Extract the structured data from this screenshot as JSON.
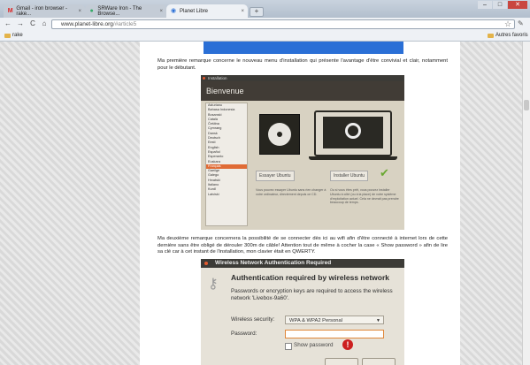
{
  "tabs": [
    {
      "icon": "gmail-icon",
      "label": "Gmail - iron browser - rake...",
      "close": "×"
    },
    {
      "icon": "srware-icon",
      "label": "SRWare Iron - The Browse...",
      "close": "×"
    },
    {
      "icon": "planet-icon",
      "label": "Planet Libre",
      "close": "×"
    }
  ],
  "new_tab": "+",
  "window_controls": {
    "minimize": "–",
    "maximize": "□",
    "close": "✕"
  },
  "nav": {
    "back": "←",
    "forward": "→",
    "reload": "C",
    "home": "⌂"
  },
  "address": {
    "host": "www.planet-libre.org",
    "path": "/#article5"
  },
  "bookmarks": {
    "left": "rake",
    "right": "Autres favoris"
  },
  "article": {
    "para1": "Ma première remarque concerne le nouveau menu d'installation qui présente l'avantage d'être convivial et clair, notamment pour le débutant.",
    "para2": "Ma deuxième remarque concernera la possibilité de se connecter dès ici au wifi afin d'être connecté à internet lors de cette dernière sans être obligé de dérouler 300m de câble! Attention tout de même à cocher la case « Show password » afin de lire sa clé car à cet instant de l'installation, mon clavier était en QWERTY."
  },
  "installer": {
    "window_title": "Installation",
    "heading": "Bienvenue",
    "languages": [
      "Asturianu",
      "Bahasa Indonesia",
      "Bosanski",
      "Català",
      "Čeština",
      "Cymraeg",
      "Dansk",
      "Deutsch",
      "Eesti",
      "English",
      "Español",
      "Esperanto",
      "Euskara",
      "Français",
      "Gaeilge",
      "Galego",
      "Hrvatski",
      "Italiano",
      "Kurdî",
      "Latviski"
    ],
    "selected_language": "Français",
    "try_button": "Essayer Ubuntu",
    "install_button": "Installer Ubuntu",
    "try_text": "Vous pouvez essayer Ubuntu sans rien changer à votre ordinateur, directement depuis ce CD.",
    "install_text": "Ou si vous êtes prêt, vous pouvez installer Ubuntu à côté (ou à la place) de votre système d'exploitation actuel. Cela ne devrait pas prendre beaucoup de temps."
  },
  "wifi_dialog": {
    "title": "Wireless Network Authentication Required",
    "heading": "Authentication required by wireless network",
    "text": "Passwords or encryption keys are required to access the wireless network 'Livebox-9a60'.",
    "security_label": "Wireless security:",
    "security_value": "WPA & WPA2 Personal",
    "password_label": "Password:",
    "show_password": "Show password"
  },
  "colors": {
    "accent_blue": "#2a6fd6",
    "ubuntu_orange": "#e06b35",
    "check_green": "#6aa832"
  }
}
